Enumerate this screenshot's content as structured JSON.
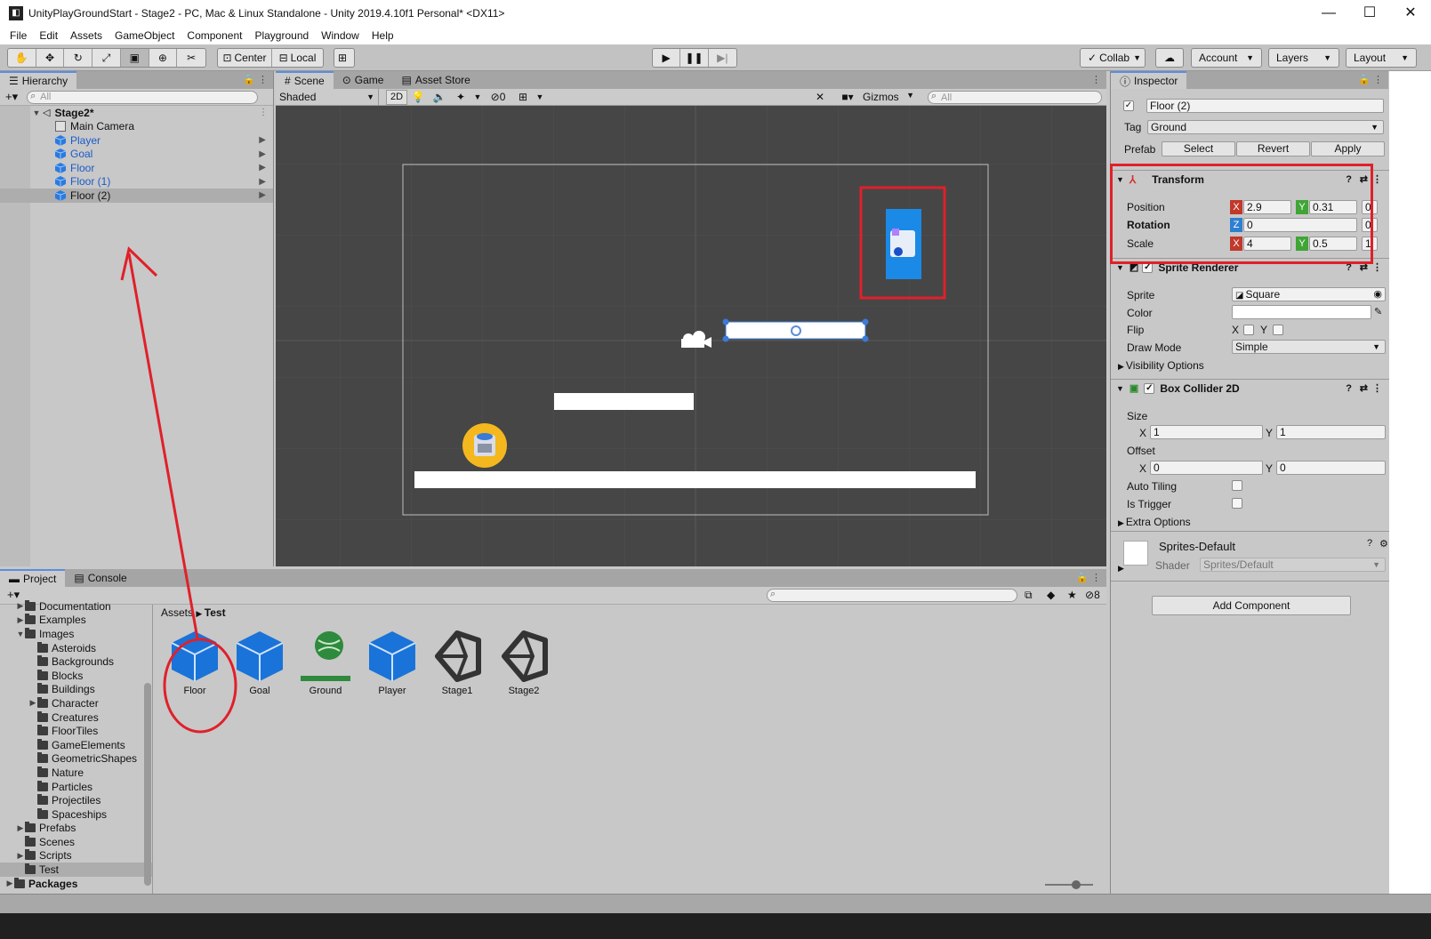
{
  "window": {
    "title": "UnityPlayGroundStart - Stage2 - PC, Mac & Linux Standalone - Unity 2019.4.10f1 Personal* <DX11>"
  },
  "menu": [
    "File",
    "Edit",
    "Assets",
    "GameObject",
    "Component",
    "Playground",
    "Window",
    "Help"
  ],
  "toolbar": {
    "pivot": "Center",
    "space": "Local",
    "collab": "Collab",
    "account": "Account",
    "layers": "Layers",
    "layout": "Layout"
  },
  "hierarchy": {
    "tab": "Hierarchy",
    "search_placeholder": "All",
    "scene": "Stage2*",
    "items": [
      {
        "label": "Main Camera"
      },
      {
        "label": "Player"
      },
      {
        "label": "Goal"
      },
      {
        "label": "Floor"
      },
      {
        "label": "Floor (1)"
      },
      {
        "label": "Floor (2)"
      }
    ]
  },
  "scene": {
    "tabs": [
      "Scene",
      "Game",
      "Asset Store"
    ],
    "shading": "Shaded",
    "mode_2d": "2D",
    "hidden_count": "0",
    "gizmos": "Gizmos",
    "search_placeholder": "All"
  },
  "inspector": {
    "tab": "Inspector",
    "object_name": "Floor (2)",
    "tag_label": "Tag",
    "tag_value": "Ground",
    "prefab_label": "Prefab",
    "prefab_buttons": [
      "Select",
      "Revert",
      "Apply"
    ],
    "transform": {
      "title": "Transform",
      "position_label": "Position",
      "rotation_label": "Rotation",
      "scale_label": "Scale",
      "position": {
        "x": "2.9",
        "y": "0.31",
        "z": "0"
      },
      "rotation": {
        "z": "0"
      },
      "scale": {
        "x": "4",
        "y": "0.5",
        "z": "1"
      }
    },
    "sprite_renderer": {
      "title": "Sprite Renderer",
      "sprite_label": "Sprite",
      "sprite_value": "Square",
      "color_label": "Color",
      "flip_label": "Flip",
      "draw_mode_label": "Draw Mode",
      "draw_mode_value": "Simple",
      "visibility": "Visibility Options"
    },
    "box_collider": {
      "title": "Box Collider 2D",
      "size_label": "Size",
      "size": {
        "x": "1",
        "y": "1"
      },
      "offset_label": "Offset",
      "offset": {
        "x": "0",
        "y": "0"
      },
      "auto_tiling": "Auto Tiling",
      "is_trigger": "Is Trigger",
      "extra": "Extra Options"
    },
    "material": {
      "name": "Sprites-Default",
      "shader_label": "Shader",
      "shader_value": "Sprites/Default"
    },
    "add_component": "Add Component"
  },
  "project": {
    "tabs": [
      "Project",
      "Console"
    ],
    "hidden_count": "8",
    "breadcrumb": {
      "root": "Assets",
      "current": "Test"
    },
    "tree": [
      {
        "label": "Documentation",
        "indent": 1,
        "arrow": "▶"
      },
      {
        "label": "Examples",
        "indent": 1,
        "arrow": "▶"
      },
      {
        "label": "Images",
        "indent": 1,
        "arrow": "▼"
      },
      {
        "label": "Asteroids",
        "indent": 2,
        "arrow": ""
      },
      {
        "label": "Backgrounds",
        "indent": 2,
        "arrow": ""
      },
      {
        "label": "Blocks",
        "indent": 2,
        "arrow": ""
      },
      {
        "label": "Buildings",
        "indent": 2,
        "arrow": ""
      },
      {
        "label": "Character",
        "indent": 2,
        "arrow": "▶"
      },
      {
        "label": "Creatures",
        "indent": 2,
        "arrow": ""
      },
      {
        "label": "FloorTiles",
        "indent": 2,
        "arrow": ""
      },
      {
        "label": "GameElements",
        "indent": 2,
        "arrow": ""
      },
      {
        "label": "GeometricShapes",
        "indent": 2,
        "arrow": ""
      },
      {
        "label": "Nature",
        "indent": 2,
        "arrow": ""
      },
      {
        "label": "Particles",
        "indent": 2,
        "arrow": ""
      },
      {
        "label": "Projectiles",
        "indent": 2,
        "arrow": ""
      },
      {
        "label": "Spaceships",
        "indent": 2,
        "arrow": ""
      },
      {
        "label": "Prefabs",
        "indent": 1,
        "arrow": "▶"
      },
      {
        "label": "Scenes",
        "indent": 1,
        "arrow": ""
      },
      {
        "label": "Scripts",
        "indent": 1,
        "arrow": "▶"
      },
      {
        "label": "Test",
        "indent": 1,
        "arrow": ""
      },
      {
        "label": "Packages",
        "indent": 0,
        "arrow": "▶"
      }
    ],
    "assets": [
      {
        "label": "Floor",
        "icon": "prefab-cube-icon"
      },
      {
        "label": "Goal",
        "icon": "prefab-cube-icon"
      },
      {
        "label": "Ground",
        "icon": "ground-sprite-icon"
      },
      {
        "label": "Player",
        "icon": "prefab-cube-icon"
      },
      {
        "label": "Stage1",
        "icon": "unity-scene-icon"
      },
      {
        "label": "Stage2",
        "icon": "unity-scene-icon"
      }
    ]
  },
  "colors": {
    "accent_blue": "#1a73d8",
    "annotation_red": "#e0202a",
    "axis_x": "#c0392b",
    "axis_y": "#3fa535",
    "axis_z": "#2f7fd1",
    "scene_bg": "#464646"
  }
}
